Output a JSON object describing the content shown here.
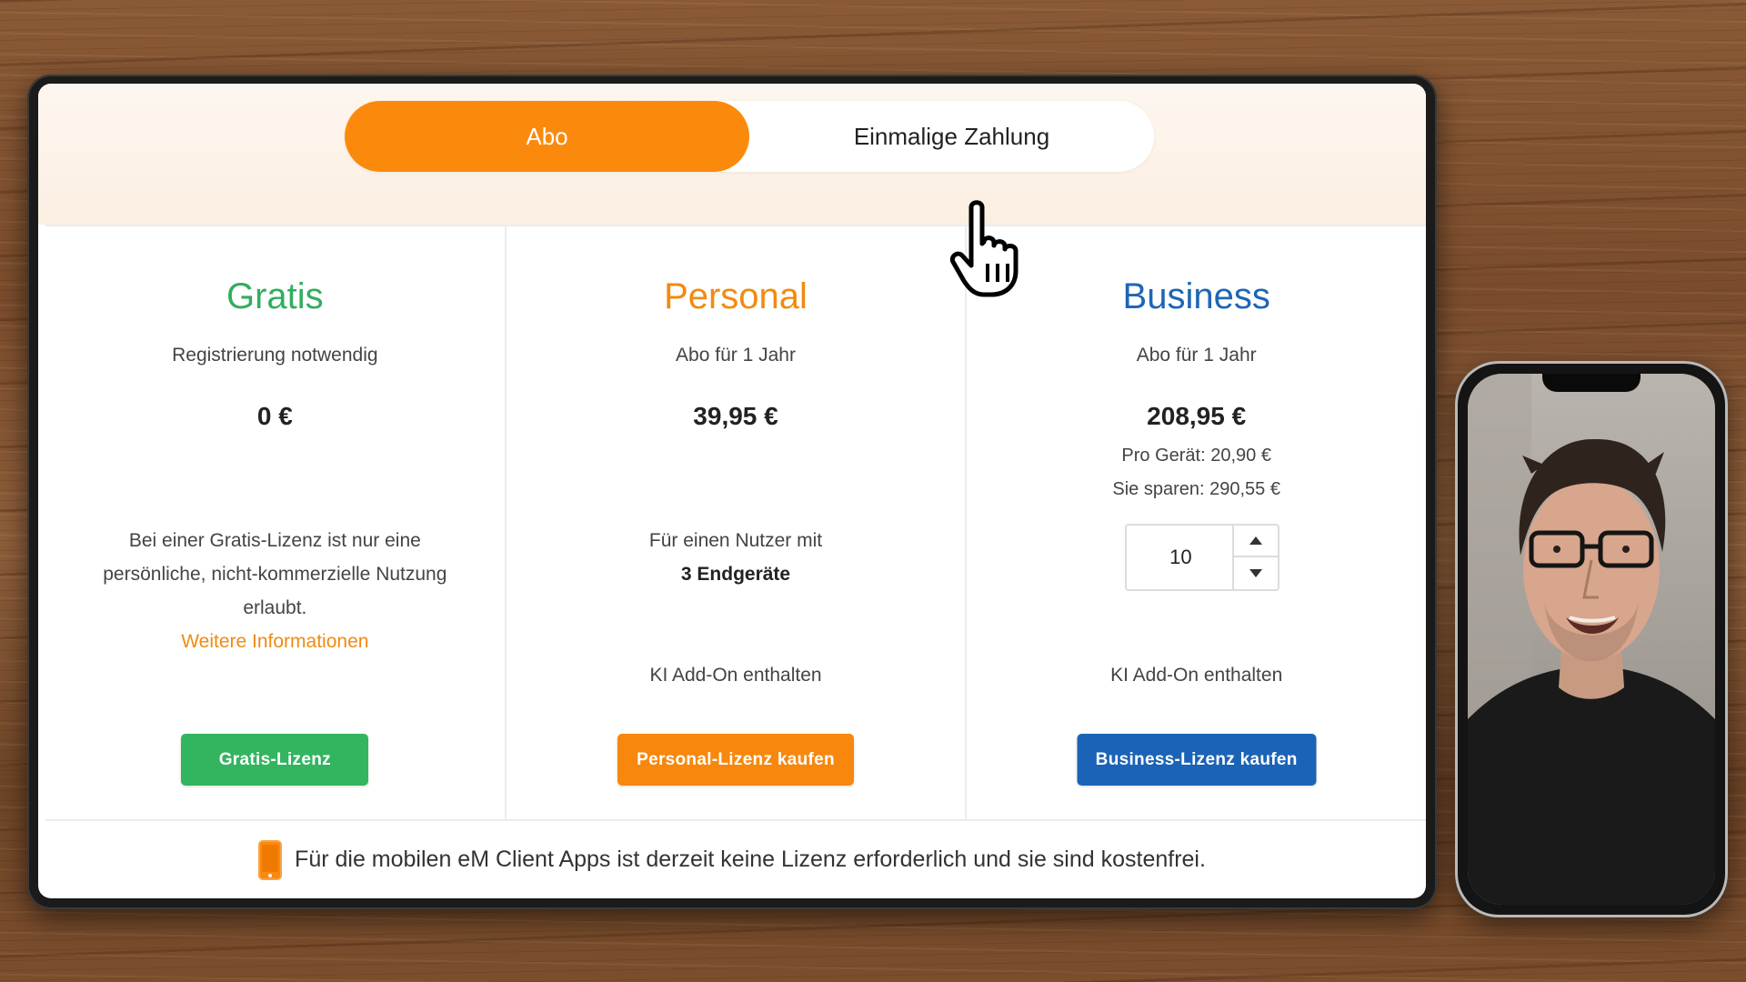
{
  "toggle": {
    "subscription_label": "Abo",
    "one_time_label": "Einmalige Zahlung"
  },
  "plans": [
    {
      "name": "Gratis",
      "subtitle": "Registrierung notwendig",
      "price": "0 €",
      "description": "Bei einer Gratis-Lizenz ist nur eine persönliche, nicht-kommerzielle Nutzung erlaubt.",
      "link": "Weitere Informationen",
      "button": "Gratis-Lizenz"
    },
    {
      "name": "Personal",
      "subtitle": "Abo für 1 Jahr",
      "price": "39,95 €",
      "description_line1": "Für einen Nutzer mit",
      "description_line2": "3 Endgeräte",
      "addon": "KI Add-On enthalten",
      "button": "Personal-Lizenz kaufen"
    },
    {
      "name": "Business",
      "subtitle": "Abo für 1 Jahr",
      "price": "208,95 €",
      "per_device": "Pro Gerät: 20,90 €",
      "savings": "Sie sparen: 290,55 €",
      "device_count": "10",
      "addon": "KI Add-On enthalten",
      "button": "Business-Lizenz kaufen"
    }
  ],
  "footer": {
    "notice": "Für die mobilen eM Client Apps ist derzeit keine Lizenz erforderlich und sie sind kostenfrei."
  },
  "colors": {
    "orange": "#fb8a0c",
    "green": "#33b560",
    "blue": "#1b63b6"
  },
  "icons": [
    "hand-pointer-cursor-icon",
    "mobile-phone-icon",
    "chevron-up-icon",
    "chevron-down-icon"
  ]
}
